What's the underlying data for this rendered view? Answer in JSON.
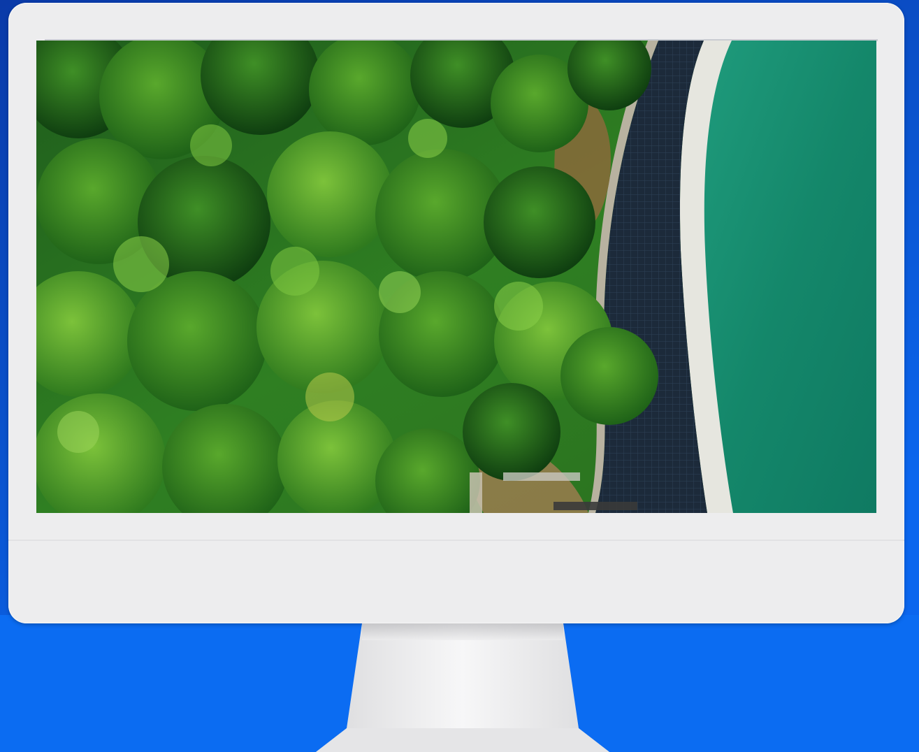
{
  "scene": {
    "background_color": "#0a6bf0",
    "monitor_color": "#ededee",
    "screen_content": "aerial-forest-reservoir-photo"
  }
}
